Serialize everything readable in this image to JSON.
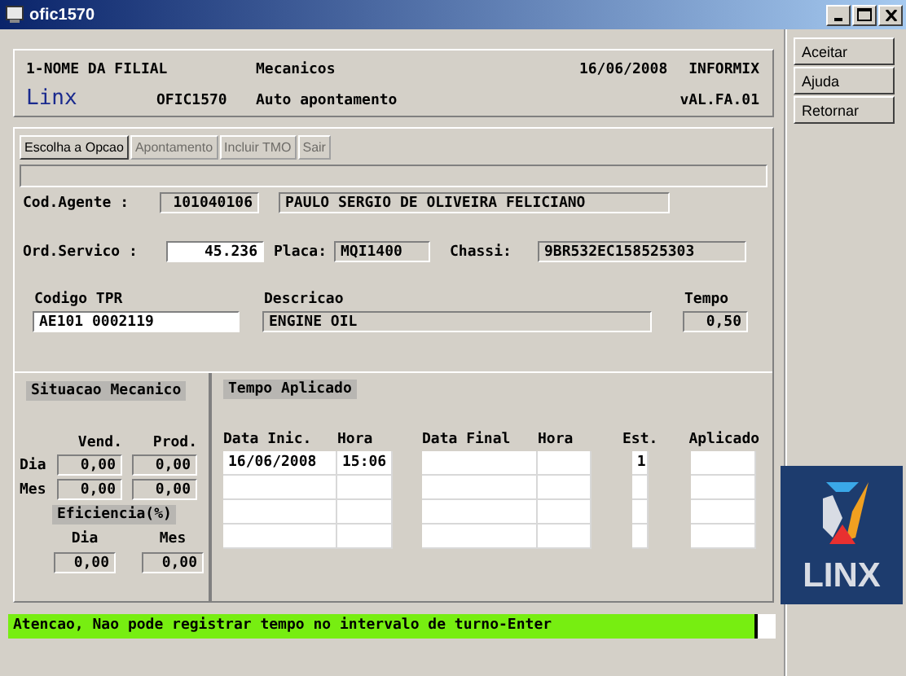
{
  "window": {
    "title": "ofic1570"
  },
  "header": {
    "branch": "1-NOME DA FILIAL",
    "module": "Mecanicos",
    "date": "16/06/2008",
    "database": "INFORMIX",
    "brand": "Linx",
    "program": "OFIC1570",
    "screen": "Auto apontamento",
    "version": "vAL.FA.01"
  },
  "side_buttons": [
    "Aceitar",
    "Ajuda",
    "Retornar"
  ],
  "tabs": [
    {
      "label": "Escolha a Opcao",
      "disabled": false
    },
    {
      "label": "Apontamento",
      "disabled": true
    },
    {
      "label": "Incluir TMO",
      "disabled": true
    },
    {
      "label": "Sair",
      "disabled": true
    }
  ],
  "agent": {
    "label": "Cod.Agente :",
    "code": "101040106",
    "name": "PAULO SERGIO DE OLIVEIRA FELICIANO"
  },
  "order": {
    "label": "Ord.Servico :",
    "value": "45.236",
    "plate_label": "Placa:",
    "plate": "MQI1400",
    "chassis_label": "Chassi:",
    "chassis": "9BR532EC158525303"
  },
  "tpr": {
    "code_label": "Codigo TPR",
    "code": "AE101 0002119",
    "desc_label": "Descricao",
    "desc": "ENGINE OIL",
    "time_label": "Tempo",
    "time": "0,50"
  },
  "mechanic": {
    "title": "Situacao Mecanico",
    "columns": [
      "Vend.",
      "Prod."
    ],
    "rows": [
      {
        "label": "Dia",
        "values": [
          "0,00",
          "0,00"
        ]
      },
      {
        "label": "Mes",
        "values": [
          "0,00",
          "0,00"
        ]
      }
    ],
    "efficiency_title": "Eficiencia(%)",
    "efficiency_columns": [
      "Dia",
      "Mes"
    ],
    "efficiency_values": [
      "0,00",
      "0,00"
    ]
  },
  "time_applied": {
    "title": "Tempo Aplicado",
    "columns": [
      "Data Inic.",
      "Hora",
      "Data Final",
      "Hora",
      "Est.",
      "Aplicado"
    ],
    "rows": [
      {
        "start_date": "16/06/2008",
        "start_time": "15:06",
        "status": "1"
      }
    ]
  },
  "logo": {
    "text": "LINX"
  },
  "status_bar": {
    "message": "Atencao, Nao pode registrar tempo no intervalo de turno-Enter"
  }
}
